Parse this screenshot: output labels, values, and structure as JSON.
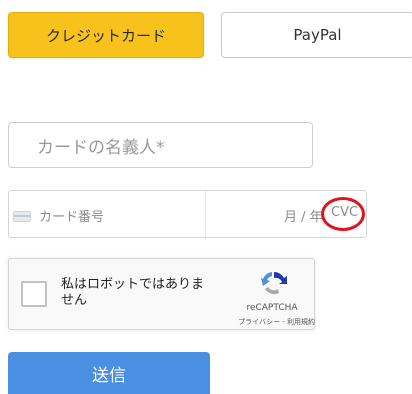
{
  "payment_tabs": {
    "card_label": "クレジットカード",
    "paypal_label": "PayPal"
  },
  "name_field": {
    "placeholder": "カードの名義人*"
  },
  "card_field": {
    "number_placeholder": "カード番号",
    "expiry_placeholder": "月 / 年",
    "cvc_placeholder": "CVC"
  },
  "captcha": {
    "label": "私はロボットではありません",
    "brand": "reCAPTCHA",
    "links": "プライバシー - 利用規約"
  },
  "submit": {
    "label": "送信"
  },
  "colors": {
    "active_tab": "#f6c21b",
    "submit": "#4a8fe2",
    "highlight": "#e0141e"
  }
}
